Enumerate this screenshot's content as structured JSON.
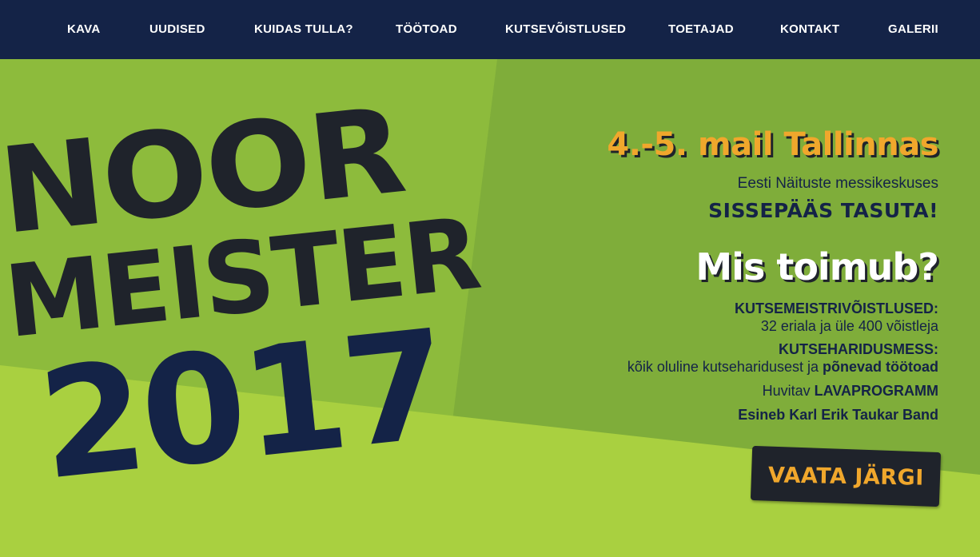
{
  "nav": {
    "items": [
      "KAVA",
      "UUDISED",
      "KUIDAS TULLA?",
      "TÖÖTOAD",
      "KUTSEVÕISTLUSED",
      "TOETAJAD",
      "KONTAKT",
      "GALERII"
    ]
  },
  "colors": {
    "nav_bg": "#142347",
    "light_green": "#8dbb3c",
    "mid_green": "#7fad3a",
    "bright_green": "#a9d040",
    "accent_orange": "#f0a72c",
    "navy": "#142347",
    "dark": "#1f232b"
  },
  "logo": {
    "line1": "NOOR",
    "line2": "MEISTER",
    "line3": "2017"
  },
  "event": {
    "date": "4.-5. mail Tallinnas",
    "venue": "Eesti Näituste messikeskuses",
    "entry": "SISSEPÄÄS TASUTA!"
  },
  "program": {
    "heading": "Mis toimub?",
    "competitions_title": "KUTSEMEISTRIVÕISTLUSED:",
    "competitions_text": "32 eriala ja üle 400 võistleja",
    "fair_title": "KUTSEHARIDUSMESS:",
    "fair_text_prefix": "kõik oluline kutseharidusest ja ",
    "fair_text_highlight": "põnevad töötoad",
    "stage_prefix": "Huvitav ",
    "stage_highlight": "LAVAPROGRAMM",
    "band": "Esineb Karl Erik Taukar Band"
  },
  "cta": {
    "label": "VAATA JÄRGI"
  }
}
